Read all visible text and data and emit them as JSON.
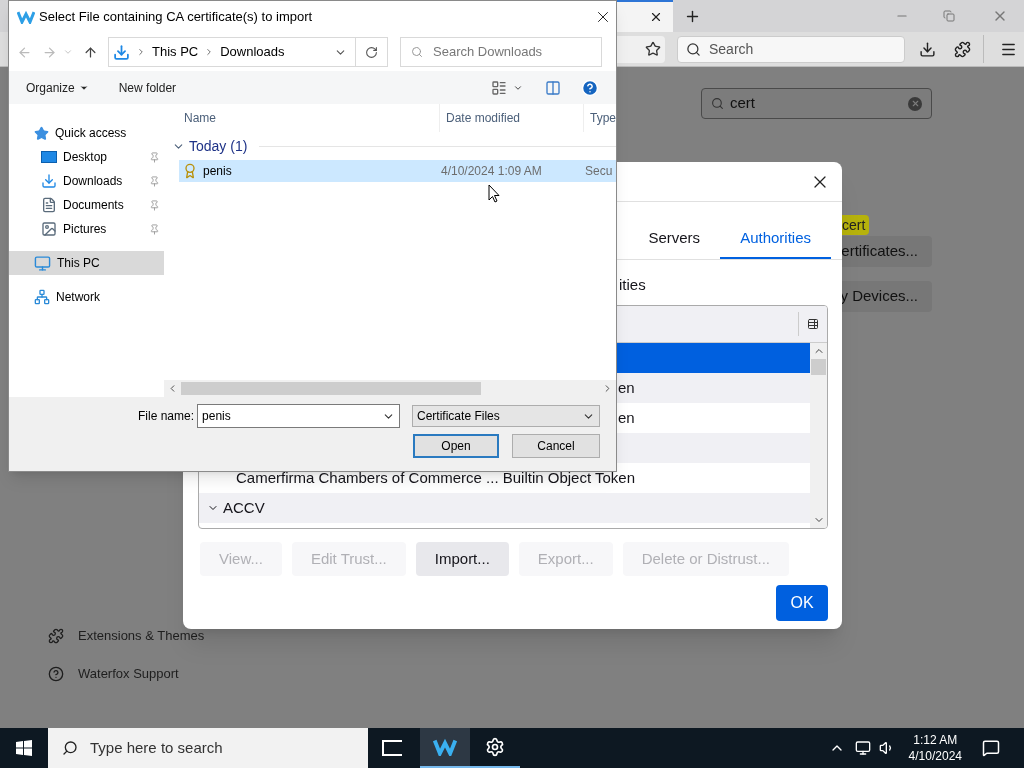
{
  "browser": {
    "toolbar": {
      "search_placeholder": "Search"
    },
    "page": {
      "search": {
        "value": "cert"
      },
      "highlight": "cert",
      "buttons": [
        "ertificates...",
        "y Devices..."
      ],
      "sidebar": [
        {
          "kind": "extensions",
          "label": "Extensions & Themes"
        },
        {
          "kind": "support",
          "label": "Waterfox Support"
        }
      ]
    }
  },
  "cert_dialog": {
    "tabs": [
      {
        "label": "Servers",
        "selected": false
      },
      {
        "label": "Authorities",
        "selected": true
      }
    ],
    "caption": "ities",
    "rows": [
      {
        "kind": "cert",
        "selected": true
      },
      {
        "kind": "clipped",
        "text": "en",
        "selected": false
      },
      {
        "kind": "clipped",
        "text": "en",
        "selected": false
      },
      {
        "kind": "cert",
        "selected": false
      },
      {
        "kind": "cert",
        "text": "Camerfirma Chambers of Commerce ... Builtin Object Token",
        "selected": false
      },
      {
        "kind": "group",
        "text": "ACCV",
        "expanded": true,
        "selected": false
      }
    ],
    "buttons": [
      {
        "label": "View...",
        "disabled": true
      },
      {
        "label": "Edit Trust...",
        "disabled": true
      },
      {
        "label": "Import...",
        "disabled": false
      },
      {
        "label": "Export...",
        "disabled": true
      },
      {
        "label": "Delete or Distrust...",
        "disabled": true
      }
    ],
    "ok": "OK"
  },
  "file_dialog": {
    "title": "Select File containing CA certificate(s) to import",
    "path": [
      "This PC",
      "Downloads"
    ],
    "search_placeholder": "Search Downloads",
    "toolbar": [
      "Organize",
      "New folder"
    ],
    "nav": [
      {
        "kind": "star",
        "label": "Quick access",
        "selected": false,
        "children": [
          {
            "kind": "desktop",
            "label": "Desktop",
            "selected": false
          },
          {
            "kind": "download",
            "label": "Downloads",
            "selected": false
          },
          {
            "kind": "document",
            "label": "Documents",
            "selected": false
          },
          {
            "kind": "pictures",
            "label": "Pictures",
            "selected": false
          }
        ]
      },
      {
        "kind": "pc",
        "label": "This PC",
        "selected": true
      },
      {
        "kind": "network",
        "label": "Network",
        "selected": false
      }
    ],
    "columns": [
      "Name",
      "Date modified",
      "Type"
    ],
    "group": {
      "label": "Today (1)",
      "expanded": true
    },
    "files": [
      {
        "name": "penis",
        "date": "4/10/2024 1:09 AM",
        "type": "Secu",
        "selected": true
      }
    ],
    "file_name_label": "File name:",
    "file_name": "penis",
    "filter": "Certificate Files",
    "buttons": [
      "Open",
      "Cancel"
    ]
  },
  "taskbar": {
    "search_placeholder": "Type here to search",
    "time": "1:12 AM",
    "date": "4/10/2024"
  }
}
